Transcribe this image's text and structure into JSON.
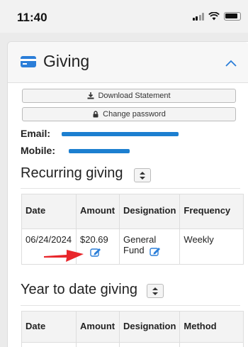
{
  "status_bar": {
    "time": "11:40",
    "icons": [
      "signal-icon",
      "wifi-icon",
      "battery-icon"
    ]
  },
  "giving": {
    "title": "Giving",
    "download_label": "Download Statement",
    "change_password_label": "Change password",
    "email_label": "Email:",
    "mobile_label": "Mobile:"
  },
  "recurring": {
    "title": "Recurring giving",
    "columns": [
      "Date",
      "Amount",
      "Designation",
      "Frequency"
    ],
    "rows": [
      {
        "date": "06/24/2024",
        "amount": "$20.69",
        "designation_line1": "General",
        "designation_line2": "Fund",
        "frequency": "Weekly"
      }
    ]
  },
  "ytd": {
    "title": "Year to date giving",
    "columns": [
      "Date",
      "Amount",
      "Designation",
      "Method"
    ]
  },
  "colors": {
    "accent": "#2b7ed8",
    "annotation_arrow": "#e8262b"
  }
}
